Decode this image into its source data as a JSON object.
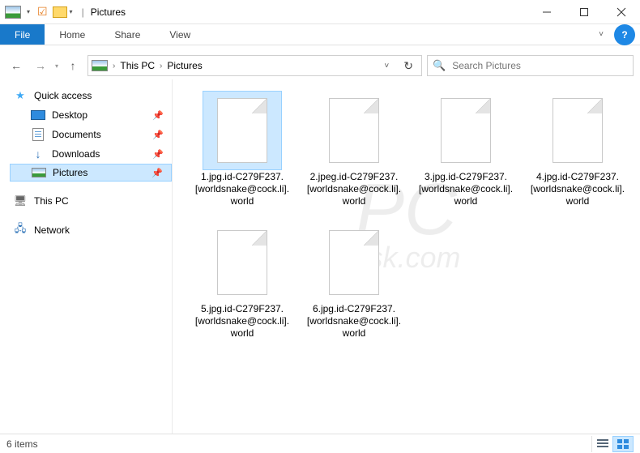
{
  "window": {
    "title": "Pictures"
  },
  "ribbon": {
    "file": "File",
    "tabs": [
      "Home",
      "Share",
      "View"
    ]
  },
  "breadcrumbs": [
    "This PC",
    "Pictures"
  ],
  "search": {
    "placeholder": "Search Pictures"
  },
  "sidebar": {
    "quick_access": "Quick access",
    "items": [
      {
        "label": "Desktop",
        "pinned": true
      },
      {
        "label": "Documents",
        "pinned": true
      },
      {
        "label": "Downloads",
        "pinned": true
      },
      {
        "label": "Pictures",
        "pinned": true,
        "selected": true
      }
    ],
    "this_pc": "This PC",
    "network": "Network"
  },
  "files": [
    "1.jpg.id-C279F237.[worldsnake@cock.li].world",
    "2.jpeg.id-C279F237.[worldsnake@cock.li].world",
    "3.jpg.id-C279F237.[worldsnake@cock.li].world",
    "4.jpg.id-C279F237.[worldsnake@cock.li].world",
    "5.jpg.id-C279F237.[worldsnake@cock.li].world",
    "6.jpg.id-C279F237.[worldsnake@cock.li].world"
  ],
  "status": {
    "text": "6 items"
  },
  "watermark": {
    "big": "PC",
    "sub": "risk.com"
  }
}
